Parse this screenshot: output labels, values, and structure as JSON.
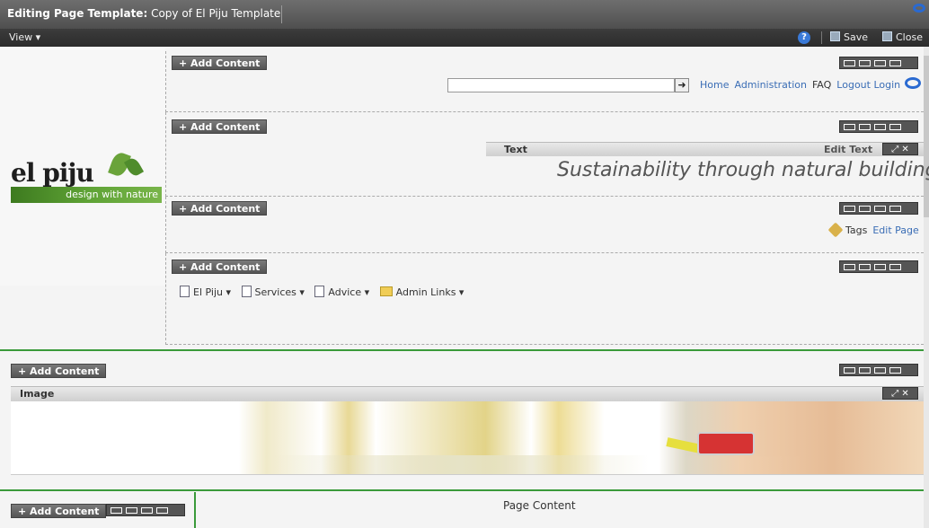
{
  "editor": {
    "title_prefix": "Editing Page Template:",
    "title_name": "Copy of El Piju Template",
    "view_menu": "View ▾",
    "help_glyph": "?",
    "save_label": "Save",
    "close_label": "Close",
    "accent_color": "#2a6ad1"
  },
  "add_content_label": "+ Add Content",
  "header": {
    "logo_word": "el piju",
    "logo_tagline": "design with nature",
    "go_glyph": "➜",
    "search_value": "",
    "nav_links": [
      "Home",
      "Administration",
      "FAQ",
      "Logout Login"
    ]
  },
  "text_portlet": {
    "label": "Text",
    "edit_label": "Edit Text",
    "ctrl": "⤢ ✕",
    "content": "Sustainability through natural building"
  },
  "tags_row": {
    "tags_label": "Tags",
    "edit_page_label": "Edit Page"
  },
  "site_nav": [
    {
      "label": "El Piju ▾",
      "icon": "page-icon"
    },
    {
      "label": "Services ▾",
      "icon": "page-icon"
    },
    {
      "label": "Advice ▾",
      "icon": "page-icon"
    },
    {
      "label": "Admin Links ▾",
      "icon": "folder-icon"
    }
  ],
  "image_portlet": {
    "label": "Image",
    "ctrl": "⤢ ✕"
  },
  "bottom": {
    "page_content_label": "Page Content"
  }
}
